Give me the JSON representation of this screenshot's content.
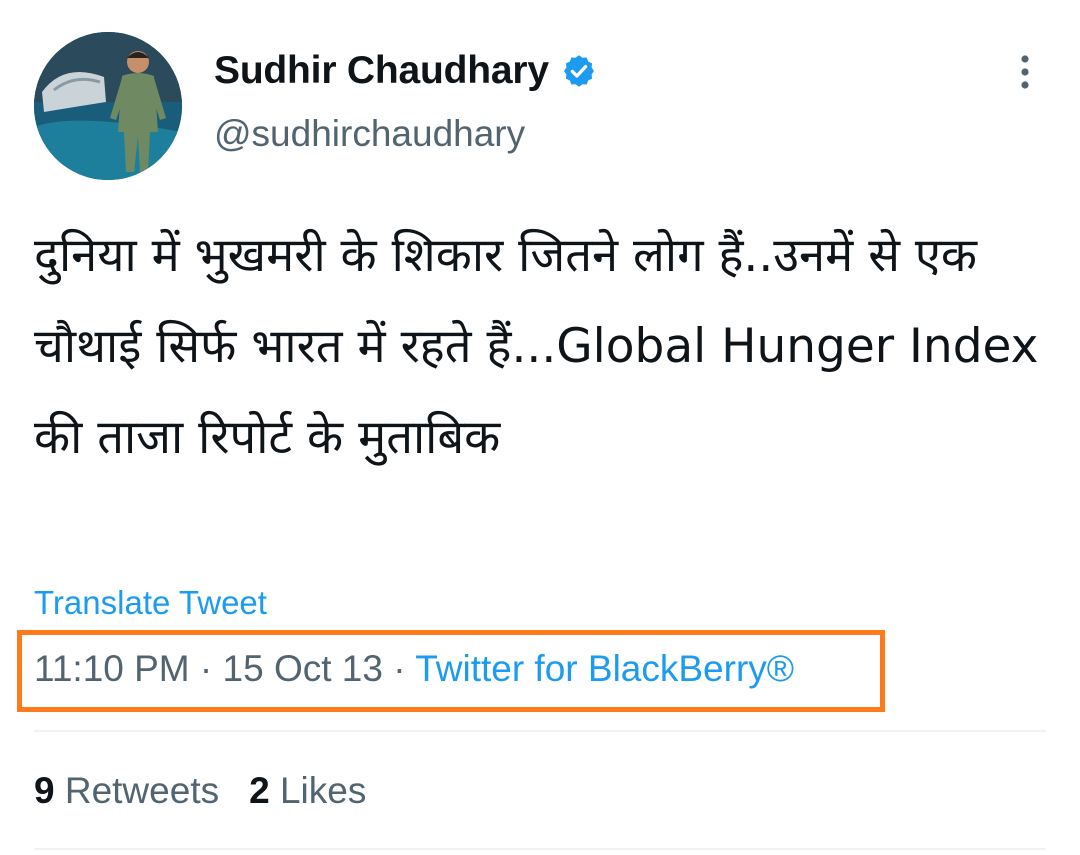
{
  "user": {
    "display_name": "Sudhir Chaudhary",
    "handle": "@sudhirchaudhary",
    "verified_icon": "verified-badge-icon",
    "avatar_icon": "avatar-photo"
  },
  "menu": {
    "icon": "more-options-icon"
  },
  "tweet": {
    "text": "दुनिया में भुखमरी के शिकार जितने लोग हैं..उनमें से एक चौथाई सिर्फ भारत में रहते हैं...Global Hunger Index की ताजा रिपोर्ट के मुताबिक",
    "translate_label": "Translate Tweet",
    "time": "11:10 PM",
    "date": "15 Oct 13",
    "separator": "·",
    "source": "Twitter for BlackBerry®"
  },
  "stats": {
    "retweets_count": "9",
    "retweets_label": "Retweets",
    "likes_count": "2",
    "likes_label": "Likes"
  },
  "colors": {
    "link": "#1d9bf0",
    "secondary_text": "#536471",
    "primary_text": "#0f1419",
    "highlight_border": "#ff7a1a",
    "divider": "#eff3f4"
  }
}
